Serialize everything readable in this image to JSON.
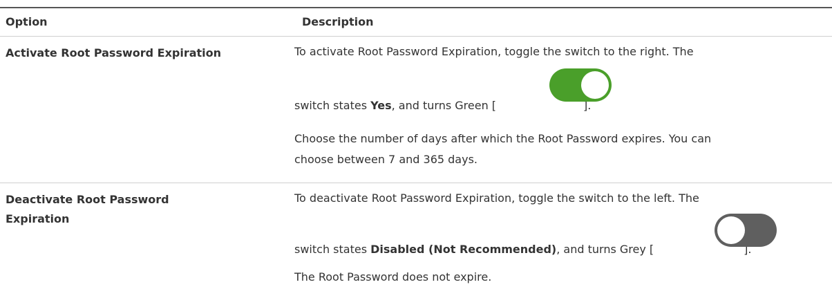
{
  "header": {
    "option": "Option",
    "description": "Description"
  },
  "rows": [
    {
      "option": "Activate Root Password Expiration",
      "desc_line1": "To activate Root Password Expiration, toggle the switch to the right. The",
      "desc_line2_pre": "switch states ",
      "desc_line2_bold": "Yes",
      "desc_line2_post": ", and turns Green [",
      "desc_line2_close": "].",
      "desc_line3": "Choose the number of days after which the Root Password expires. You can",
      "desc_line4": "choose between 7 and 365 days.",
      "toggle_state": "on",
      "toggle_color": "#4a9f2a"
    },
    {
      "option_line1": "Deactivate Root Password",
      "option_line2": "Expiration",
      "desc_line1": "To deactivate Root Password Expiration, toggle the switch to the left. The",
      "desc_line2_pre": "switch states ",
      "desc_line2_bold": "Disabled (Not Recommended)",
      "desc_line2_post": ", and turns Grey [",
      "desc_line2_close": "].",
      "desc_line3": "The Root Password does not expire.",
      "toggle_state": "off",
      "toggle_color": "#5f5f5f"
    }
  ]
}
